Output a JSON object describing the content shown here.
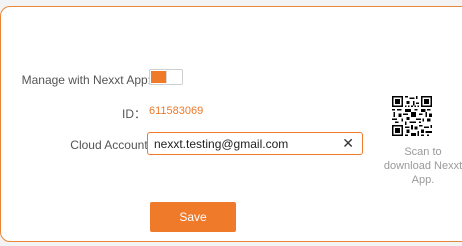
{
  "nexxt_app": {
    "manage_label": "Manage with Nexxt App:",
    "manage_enabled": true,
    "id_label": "ID：",
    "id_value": "611583069",
    "cloud_account_label": "Cloud Account:",
    "cloud_account_value": "nexxt.testing@gmail.com",
    "clear_glyph": "✕",
    "save_label": "Save",
    "qr_caption": "Scan to download Nexxt App.",
    "accent_color": "#ee7a2a"
  }
}
